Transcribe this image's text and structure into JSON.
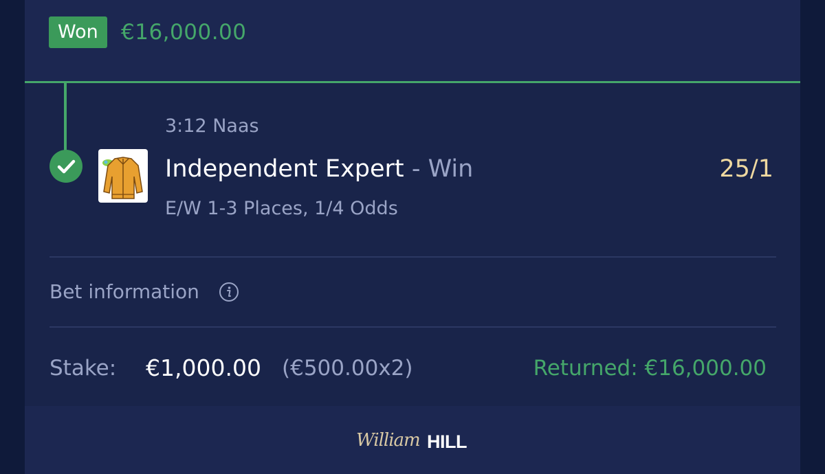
{
  "header": {
    "status_badge": "Won",
    "won_amount": "€16,000.00"
  },
  "selection": {
    "race": "3:12 Naas",
    "runner": "Independent Expert",
    "separator": "-",
    "market": "Win",
    "odds": "25/1",
    "each_way_terms": "E/W 1-3 Places, 1/4 Odds",
    "silks_icon": "jockey-silks-orange"
  },
  "bet_information": {
    "label": "Bet information",
    "icon": "info-icon"
  },
  "stake": {
    "label": "Stake:",
    "value": "€1,000.00",
    "split": "(€500.00x2)",
    "returned": "Returned: €16,000.00"
  },
  "footer": {
    "logo_script": "William",
    "logo_bold": "HILL"
  },
  "colors": {
    "background": "#0f1a3a",
    "card": "#1a2550",
    "success_green": "#45a76a",
    "badge_green": "#3b9a5a",
    "odds_gold": "#efd9a0",
    "muted_text": "#9aa4c6"
  }
}
